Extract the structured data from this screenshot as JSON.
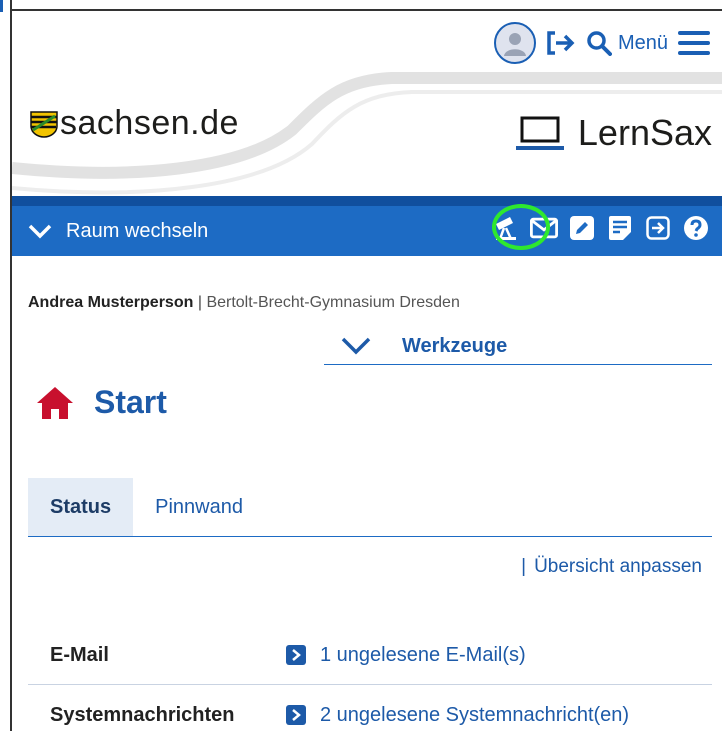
{
  "header": {
    "menu_label": "Menü",
    "sachsen_logo_text": "sachsen.de",
    "lernsax_logo_text": "LernSax"
  },
  "bluebar": {
    "room_switch_label": "Raum wechseln",
    "icons": [
      "telescope-icon",
      "mail-icon",
      "edit-icon",
      "notes-icon",
      "login-icon",
      "help-icon"
    ]
  },
  "user": {
    "name": "Andrea Musterperson",
    "separator": "|",
    "school": "Bertolt-Brecht-Gymnasium Dresden"
  },
  "tools": {
    "label": "Werkzeuge"
  },
  "page": {
    "title": "Start"
  },
  "tabs": [
    {
      "label": "Status",
      "active": true
    },
    {
      "label": "Pinnwand",
      "active": false
    }
  ],
  "overview": {
    "separator": "|",
    "label": "Übersicht anpassen"
  },
  "status_rows": [
    {
      "label": "E-Mail",
      "link": "1 ungelesene E-Mail(s)"
    },
    {
      "label": "Systemnachrichten",
      "link": "2 ungelesene Systemnachricht(en)"
    }
  ],
  "colors": {
    "brand_blue": "#1d6bc4",
    "link_blue": "#1d5aa8",
    "home_red": "#c8102e",
    "highlight_green": "#2ee82e"
  }
}
